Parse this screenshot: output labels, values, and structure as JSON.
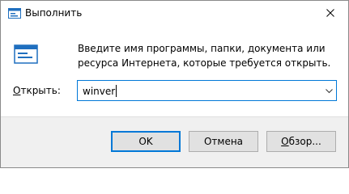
{
  "window": {
    "title": "Выполнить",
    "title_icon": "run-dialog-icon",
    "close_icon": "close-icon"
  },
  "main": {
    "icon": "run-program-icon",
    "description": "Введите имя программы, папки, документа или ресурса Интернета, которые требуется открыть."
  },
  "open_field": {
    "label_mnemonic": "О",
    "label_rest": "ткрыть:",
    "value": "winver",
    "dropdown_icon": "chevron-down-icon"
  },
  "buttons": {
    "ok_label": "OK",
    "cancel_label": "Отмена",
    "browse_mnemonic": "О",
    "browse_rest": "бзор..."
  },
  "colors": {
    "accent": "#0078d7",
    "footer_bg": "#f0f0f0",
    "button_bg": "#e1e1e1"
  }
}
